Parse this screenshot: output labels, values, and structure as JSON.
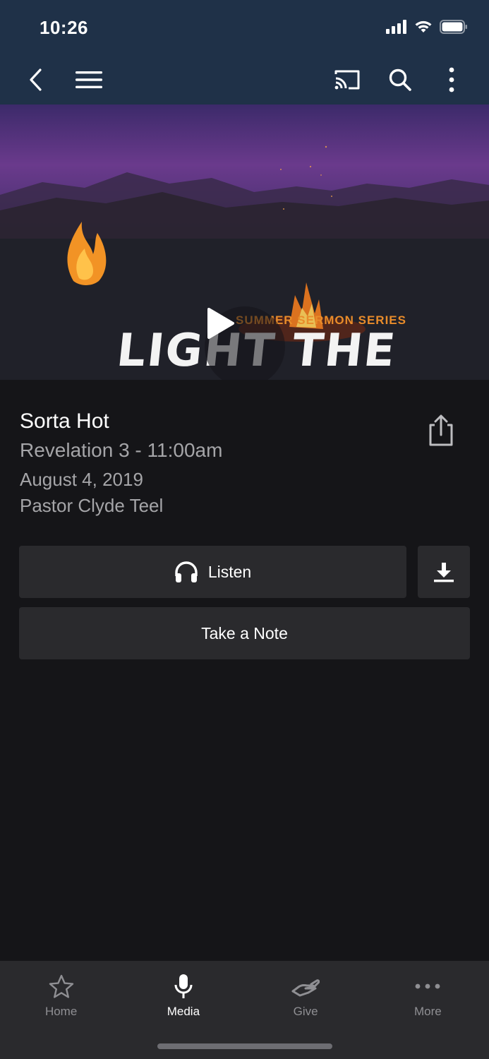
{
  "status_bar": {
    "time": "10:26"
  },
  "nav": {
    "icons": [
      "back-icon",
      "menu-icon",
      "cast-icon",
      "search-icon",
      "more-vertical-icon"
    ]
  },
  "hero": {
    "series_tag": "SUMMER SERMON SERIES",
    "series_title": "LIGHT THE FIRE"
  },
  "sermon": {
    "title": "Sorta Hot",
    "subtitle": "Revelation 3 - 11:00am",
    "date": "August 4, 2019",
    "speaker": "Pastor Clyde Teel"
  },
  "actions": {
    "listen_label": "Listen",
    "note_label": "Take a Note"
  },
  "tabbar": {
    "items": [
      {
        "label": "Home",
        "icon": "star-icon",
        "active": false
      },
      {
        "label": "Media",
        "icon": "microphone-icon",
        "active": true
      },
      {
        "label": "Give",
        "icon": "giving-hand-icon",
        "active": false
      },
      {
        "label": "More",
        "icon": "more-horizontal-icon",
        "active": false
      }
    ]
  },
  "colors": {
    "header_bg": "#1f3148",
    "page_bg": "#151518",
    "button_bg": "#2a2a2d",
    "accent_orange": "#e98c2a",
    "secondary_text": "#a5a5a8"
  }
}
